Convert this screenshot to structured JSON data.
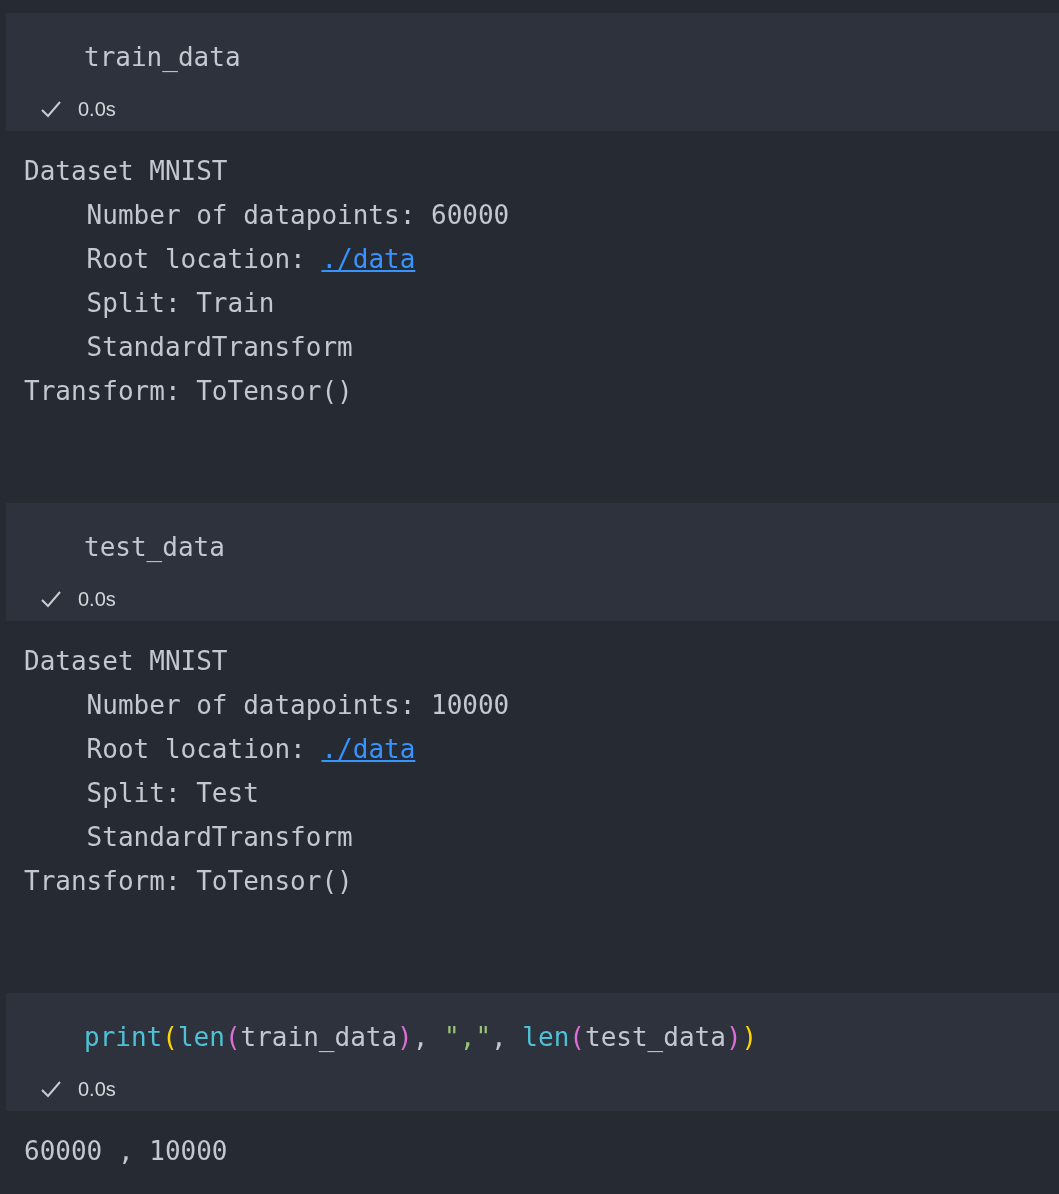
{
  "cells": [
    {
      "code": [
        {
          "kind": "plain",
          "text": "train_data"
        }
      ],
      "status": {
        "success": true,
        "time": "0.0s"
      },
      "output": [
        [
          {
            "kind": "text",
            "text": "Dataset MNIST"
          }
        ],
        [
          {
            "kind": "text",
            "text": "    Number of datapoints: 60000"
          }
        ],
        [
          {
            "kind": "text",
            "text": "    Root location: "
          },
          {
            "kind": "link",
            "text": "./data"
          }
        ],
        [
          {
            "kind": "text",
            "text": "    Split: Train"
          }
        ],
        [
          {
            "kind": "text",
            "text": "    StandardTransform"
          }
        ],
        [
          {
            "kind": "text",
            "text": "Transform: ToTensor()"
          }
        ]
      ]
    },
    {
      "code": [
        {
          "kind": "plain",
          "text": "test_data"
        }
      ],
      "status": {
        "success": true,
        "time": "0.0s"
      },
      "output": [
        [
          {
            "kind": "text",
            "text": "Dataset MNIST"
          }
        ],
        [
          {
            "kind": "text",
            "text": "    Number of datapoints: 10000"
          }
        ],
        [
          {
            "kind": "text",
            "text": "    Root location: "
          },
          {
            "kind": "link",
            "text": "./data"
          }
        ],
        [
          {
            "kind": "text",
            "text": "    Split: Test"
          }
        ],
        [
          {
            "kind": "text",
            "text": "    StandardTransform"
          }
        ],
        [
          {
            "kind": "text",
            "text": "Transform: ToTensor()"
          }
        ]
      ]
    },
    {
      "code": [
        {
          "kind": "function",
          "text": "print"
        },
        {
          "kind": "bracket1",
          "text": "("
        },
        {
          "kind": "function",
          "text": "len"
        },
        {
          "kind": "bracket2",
          "text": "("
        },
        {
          "kind": "plain",
          "text": "train_data"
        },
        {
          "kind": "bracket2",
          "text": ")"
        },
        {
          "kind": "plain",
          "text": ", "
        },
        {
          "kind": "string",
          "text": "\",\""
        },
        {
          "kind": "plain",
          "text": ", "
        },
        {
          "kind": "function",
          "text": "len"
        },
        {
          "kind": "bracket2",
          "text": "("
        },
        {
          "kind": "plain",
          "text": "test_data"
        },
        {
          "kind": "bracket2",
          "text": ")"
        },
        {
          "kind": "bracket1",
          "text": ")"
        }
      ],
      "status": {
        "success": true,
        "time": "0.0s"
      },
      "output": [
        [
          {
            "kind": "text",
            "text": "60000 , 10000"
          }
        ]
      ]
    }
  ]
}
